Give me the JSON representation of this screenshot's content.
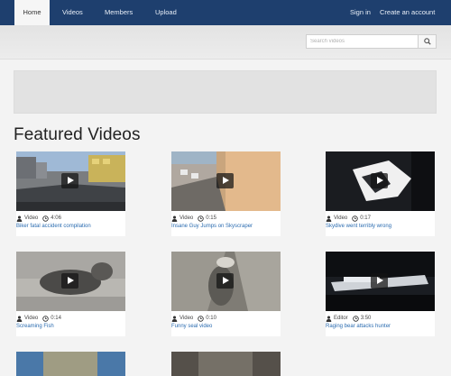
{
  "nav": {
    "items": [
      {
        "label": "Home",
        "active": true
      },
      {
        "label": "Videos",
        "active": false
      },
      {
        "label": "Members",
        "active": false
      },
      {
        "label": "Upload",
        "active": false
      }
    ],
    "sign_in": "Sign in",
    "create_account": "Create an account"
  },
  "search": {
    "placeholder": "Search videos",
    "icon": "search-icon"
  },
  "section_title": "Featured Videos",
  "videos": [
    {
      "author": "Video",
      "duration": "4:06",
      "title": "Biker fatal accident compilation"
    },
    {
      "author": "Video",
      "duration": "0:15",
      "title": "Insane Guy Jumps on Skyscraper"
    },
    {
      "author": "Video",
      "duration": "0:17",
      "title": "Skydive went terribly wrong"
    },
    {
      "author": "Video",
      "duration": "0:14",
      "title": "Screaming Fish"
    },
    {
      "author": "Video",
      "duration": "0:10",
      "title": "Funny seal video"
    },
    {
      "author": "Editor",
      "duration": "3:50",
      "title": "Raging bear attacks hunter"
    }
  ],
  "colors": {
    "nav_bg": "#1e3f6e",
    "link": "#2b6cb0",
    "page_bg": "#f3f3f3"
  }
}
